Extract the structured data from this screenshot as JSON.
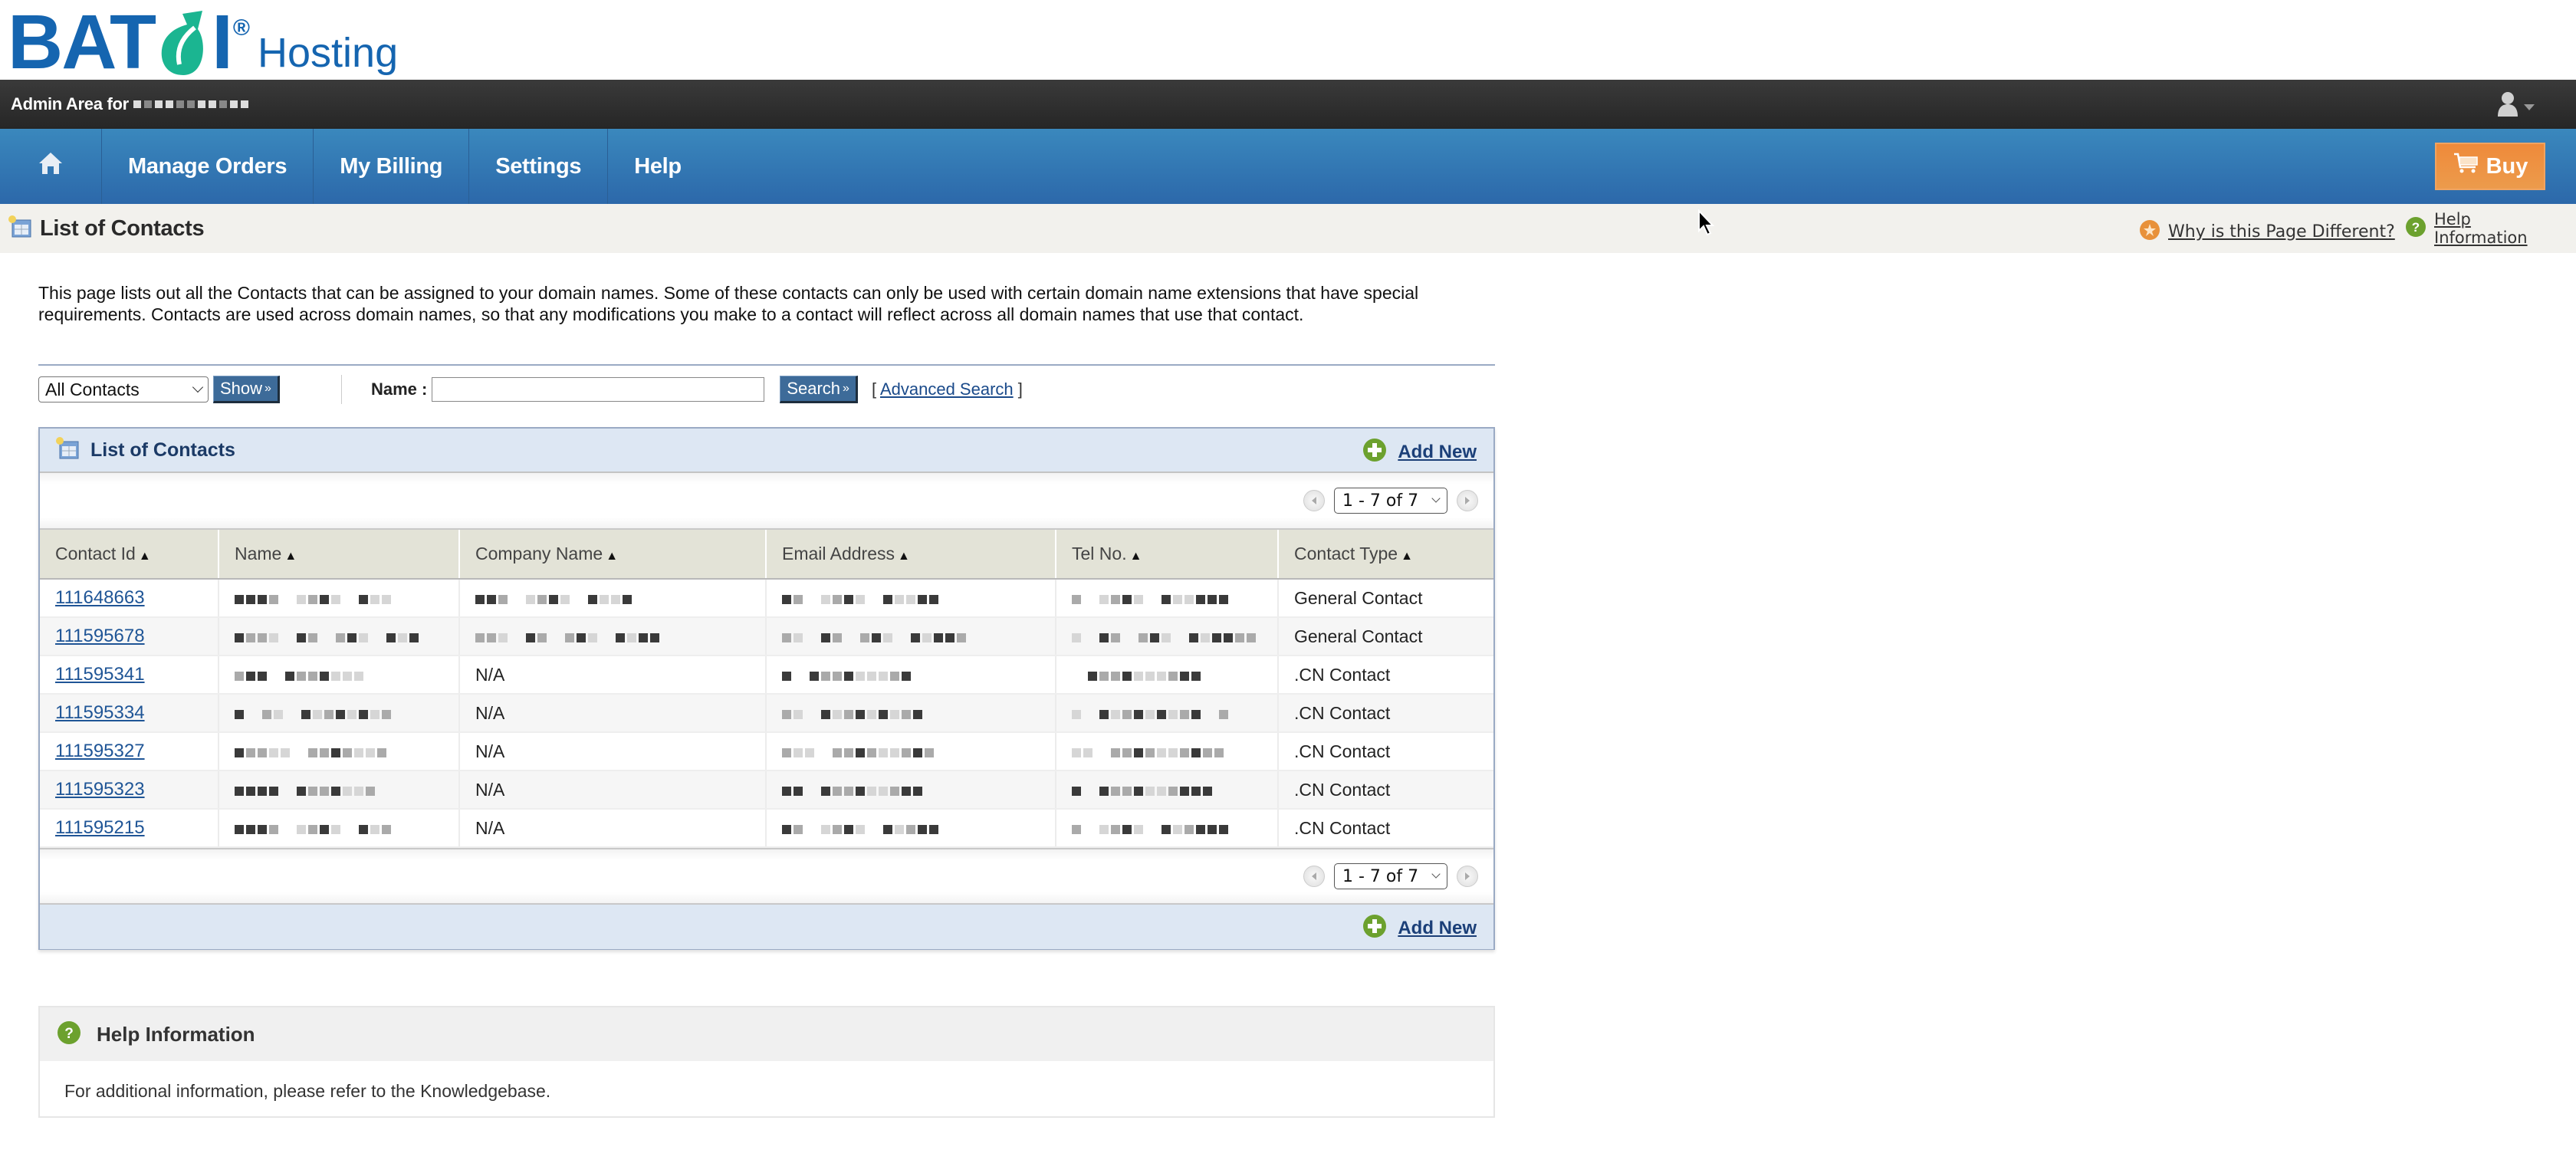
{
  "brand": {
    "logo_text_left": "BAT",
    "logo_text_right": "I",
    "registered": "®",
    "subtitle": "Hosting",
    "primary_color": "#1565b0",
    "leaf_color": "#1bb591"
  },
  "admin_bar": {
    "label": "Admin Area for",
    "account_name_redacted": true,
    "user_menu_icon": "user-icon"
  },
  "nav": {
    "home_icon": "home-icon",
    "items": [
      {
        "label": "Manage Orders"
      },
      {
        "label": "My Billing"
      },
      {
        "label": "Settings"
      },
      {
        "label": "Help"
      }
    ],
    "buy_label": "Buy",
    "buy_icon": "cart-icon",
    "bar_color": "#2f73b0",
    "buy_color": "#ee8c3d"
  },
  "title_bar": {
    "title": "List of Contacts",
    "why_link": "Why is this Page Different?",
    "help_link": "Help Information"
  },
  "description": "This page lists out all the Contacts that can be assigned to your domain names. Some of these contacts can only be used with certain domain name extensions that have special requirements. Contacts are used across domain names, so that any modifications you make to a contact will reflect across all domain names that use that contact.",
  "filter": {
    "select_value": "All Contacts",
    "show_label": "Show",
    "name_label": "Name :",
    "name_value": "",
    "search_label": "Search",
    "advanced_search_label": "Advanced Search",
    "bracket_open": "[",
    "bracket_close": "]"
  },
  "panel": {
    "title": "List of Contacts",
    "add_new_label": "Add New",
    "pager_label": "1 - 7 of 7",
    "columns": [
      {
        "label": "Contact Id"
      },
      {
        "label": "Name"
      },
      {
        "label": "Company Name"
      },
      {
        "label": "Email Address"
      },
      {
        "label": "Tel No."
      },
      {
        "label": "Contact Type"
      }
    ],
    "sort_glyph": "▲",
    "rows": [
      {
        "id": "111648663",
        "name": "[redacted]",
        "company": "[redacted]",
        "email": "[redacted]",
        "tel": "[redacted]",
        "type": "General Contact"
      },
      {
        "id": "111595678",
        "name": "[redacted]",
        "company": "[redacted]",
        "email": "[redacted]",
        "tel": "[redacted]",
        "type": "General Contact"
      },
      {
        "id": "111595341",
        "name": "[redacted]",
        "company": "N/A",
        "email": "[redacted]",
        "tel": "[redacted]",
        "type": ".CN Contact"
      },
      {
        "id": "111595334",
        "name": "[redacted]",
        "company": "N/A",
        "email": "[redacted]",
        "tel": "[redacted]",
        "type": ".CN Contact"
      },
      {
        "id": "111595327",
        "name": "[redacted]",
        "company": "N/A",
        "email": "[redacted]",
        "tel": "[redacted]",
        "type": ".CN Contact"
      },
      {
        "id": "111595323",
        "name": "[redacted]",
        "company": "N/A",
        "email": "[redacted]",
        "tel": "[redacted]",
        "type": ".CN Contact"
      },
      {
        "id": "111595215",
        "name": "[redacted]",
        "company": "N/A",
        "email": "[redacted]",
        "tel": "[redacted]",
        "type": ".CN Contact"
      }
    ]
  },
  "help_box": {
    "title": "Help Information",
    "body": "For additional information, please refer to the Knowledgebase."
  }
}
